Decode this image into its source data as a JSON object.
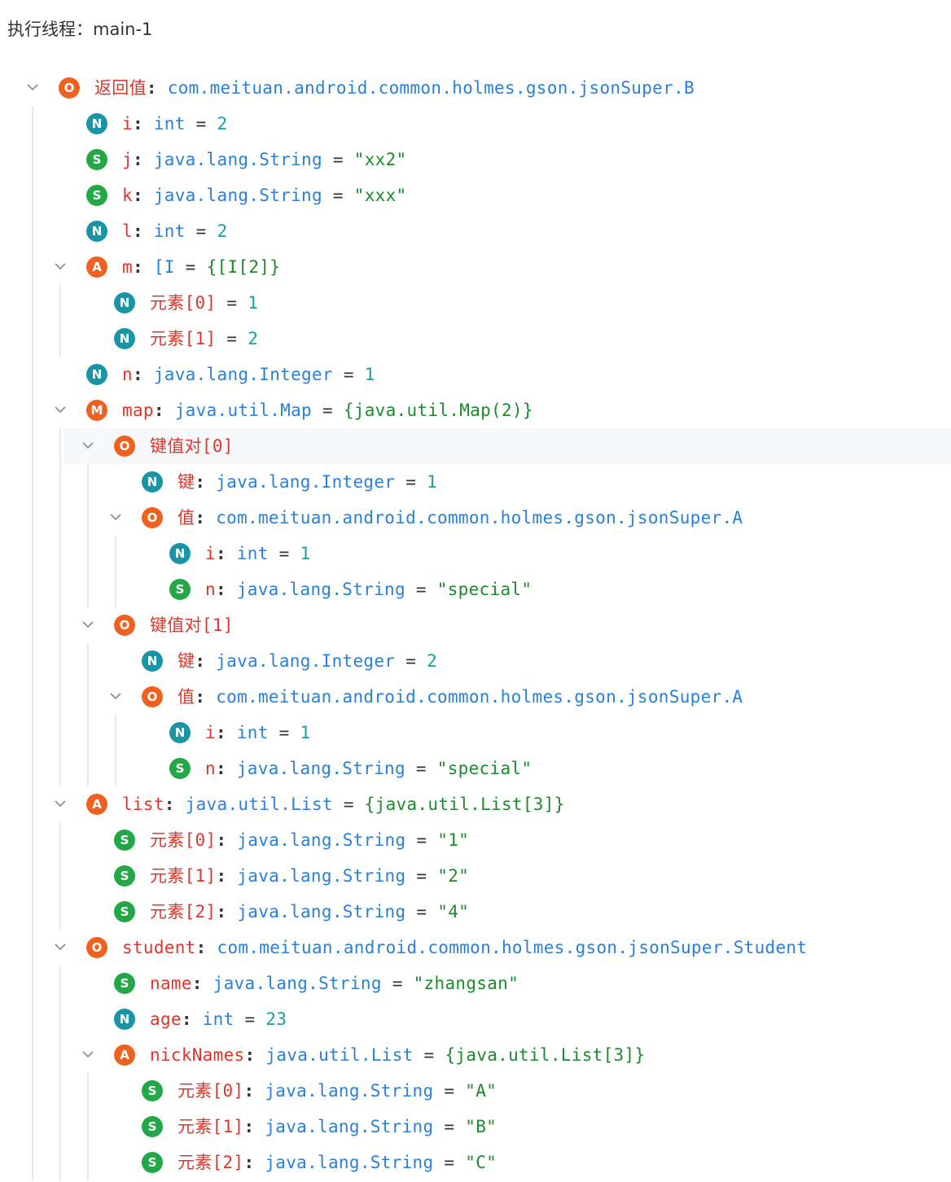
{
  "header": {
    "label": "执行线程：",
    "thread": "main-1"
  },
  "colors": {
    "key": "#e0352b",
    "type": "#2b7fd6",
    "number": "#1a9ea0",
    "string": "#1e8a2e",
    "badge_O": "#f0611f",
    "badge_N": "#1995a8",
    "badge_S": "#23a848",
    "badge_A": "#f0611f",
    "badge_M": "#f0611f"
  },
  "rows": [
    {
      "depth": 0,
      "arrow": true,
      "badge": "O",
      "key": "返回值",
      "type": "com.meituan.android.common.holmes.gson.jsonSuper.B",
      "value": "",
      "vk": ""
    },
    {
      "depth": 1,
      "arrow": false,
      "badge": "N",
      "key": "i",
      "type": "int",
      "value": "2",
      "vk": "num"
    },
    {
      "depth": 1,
      "arrow": false,
      "badge": "S",
      "key": "j",
      "type": "java.lang.String",
      "value": "\"xx2\"",
      "vk": "str"
    },
    {
      "depth": 1,
      "arrow": false,
      "badge": "S",
      "key": "k",
      "type": "java.lang.String",
      "value": "\"xxx\"",
      "vk": "str"
    },
    {
      "depth": 1,
      "arrow": false,
      "badge": "N",
      "key": "l",
      "type": "int",
      "value": "2",
      "vk": "num"
    },
    {
      "depth": 1,
      "arrow": true,
      "badge": "A",
      "key": "m",
      "type": "[I",
      "value": "{[I[2]}",
      "vk": "str"
    },
    {
      "depth": 2,
      "arrow": false,
      "badge": "N",
      "key": "元素[0]",
      "type": "",
      "value": "1",
      "vk": "num"
    },
    {
      "depth": 2,
      "arrow": false,
      "badge": "N",
      "key": "元素[1]",
      "type": "",
      "value": "2",
      "vk": "num"
    },
    {
      "depth": 1,
      "arrow": false,
      "badge": "N",
      "key": "n",
      "type": "java.lang.Integer",
      "value": "1",
      "vk": "num"
    },
    {
      "depth": 1,
      "arrow": true,
      "badge": "M",
      "key": "map",
      "type": "java.util.Map",
      "value": "{java.util.Map(2)}",
      "vk": "str"
    },
    {
      "depth": 2,
      "arrow": true,
      "badge": "O",
      "key": "键值对[0]",
      "type": "",
      "value": "",
      "vk": "",
      "hl": true,
      "nocolon": true
    },
    {
      "depth": 3,
      "arrow": false,
      "badge": "N",
      "key": "键",
      "type": "java.lang.Integer",
      "value": "1",
      "vk": "num"
    },
    {
      "depth": 3,
      "arrow": true,
      "badge": "O",
      "key": "值",
      "type": "com.meituan.android.common.holmes.gson.jsonSuper.A",
      "value": "",
      "vk": ""
    },
    {
      "depth": 4,
      "arrow": false,
      "badge": "N",
      "key": "i",
      "type": "int",
      "value": "1",
      "vk": "num"
    },
    {
      "depth": 4,
      "arrow": false,
      "badge": "S",
      "key": "n",
      "type": "java.lang.String",
      "value": "\"special\"",
      "vk": "str"
    },
    {
      "depth": 2,
      "arrow": true,
      "badge": "O",
      "key": "键值对[1]",
      "type": "",
      "value": "",
      "vk": "",
      "nocolon": true
    },
    {
      "depth": 3,
      "arrow": false,
      "badge": "N",
      "key": "键",
      "type": "java.lang.Integer",
      "value": "2",
      "vk": "num"
    },
    {
      "depth": 3,
      "arrow": true,
      "badge": "O",
      "key": "值",
      "type": "com.meituan.android.common.holmes.gson.jsonSuper.A",
      "value": "",
      "vk": ""
    },
    {
      "depth": 4,
      "arrow": false,
      "badge": "N",
      "key": "i",
      "type": "int",
      "value": "1",
      "vk": "num"
    },
    {
      "depth": 4,
      "arrow": false,
      "badge": "S",
      "key": "n",
      "type": "java.lang.String",
      "value": "\"special\"",
      "vk": "str"
    },
    {
      "depth": 1,
      "arrow": true,
      "badge": "A",
      "key": "list",
      "type": "java.util.List",
      "value": "{java.util.List[3]}",
      "vk": "str"
    },
    {
      "depth": 2,
      "arrow": false,
      "badge": "S",
      "key": "元素[0]",
      "type": "java.lang.String",
      "value": "\"1\"",
      "vk": "str"
    },
    {
      "depth": 2,
      "arrow": false,
      "badge": "S",
      "key": "元素[1]",
      "type": "java.lang.String",
      "value": "\"2\"",
      "vk": "str"
    },
    {
      "depth": 2,
      "arrow": false,
      "badge": "S",
      "key": "元素[2]",
      "type": "java.lang.String",
      "value": "\"4\"",
      "vk": "str"
    },
    {
      "depth": 1,
      "arrow": true,
      "badge": "O",
      "key": "student",
      "type": "com.meituan.android.common.holmes.gson.jsonSuper.Student",
      "value": "",
      "vk": ""
    },
    {
      "depth": 2,
      "arrow": false,
      "badge": "S",
      "key": "name",
      "type": "java.lang.String",
      "value": "\"zhangsan\"",
      "vk": "str"
    },
    {
      "depth": 2,
      "arrow": false,
      "badge": "N",
      "key": "age",
      "type": "int",
      "value": "23",
      "vk": "num"
    },
    {
      "depth": 2,
      "arrow": true,
      "badge": "A",
      "key": "nickNames",
      "type": "java.util.List",
      "value": "{java.util.List[3]}",
      "vk": "str"
    },
    {
      "depth": 3,
      "arrow": false,
      "badge": "S",
      "key": "元素[0]",
      "type": "java.lang.String",
      "value": "\"A\"",
      "vk": "str"
    },
    {
      "depth": 3,
      "arrow": false,
      "badge": "S",
      "key": "元素[1]",
      "type": "java.lang.String",
      "value": "\"B\"",
      "vk": "str"
    },
    {
      "depth": 3,
      "arrow": false,
      "badge": "S",
      "key": "元素[2]",
      "type": "java.lang.String",
      "value": "\"C\"",
      "vk": "str"
    }
  ]
}
